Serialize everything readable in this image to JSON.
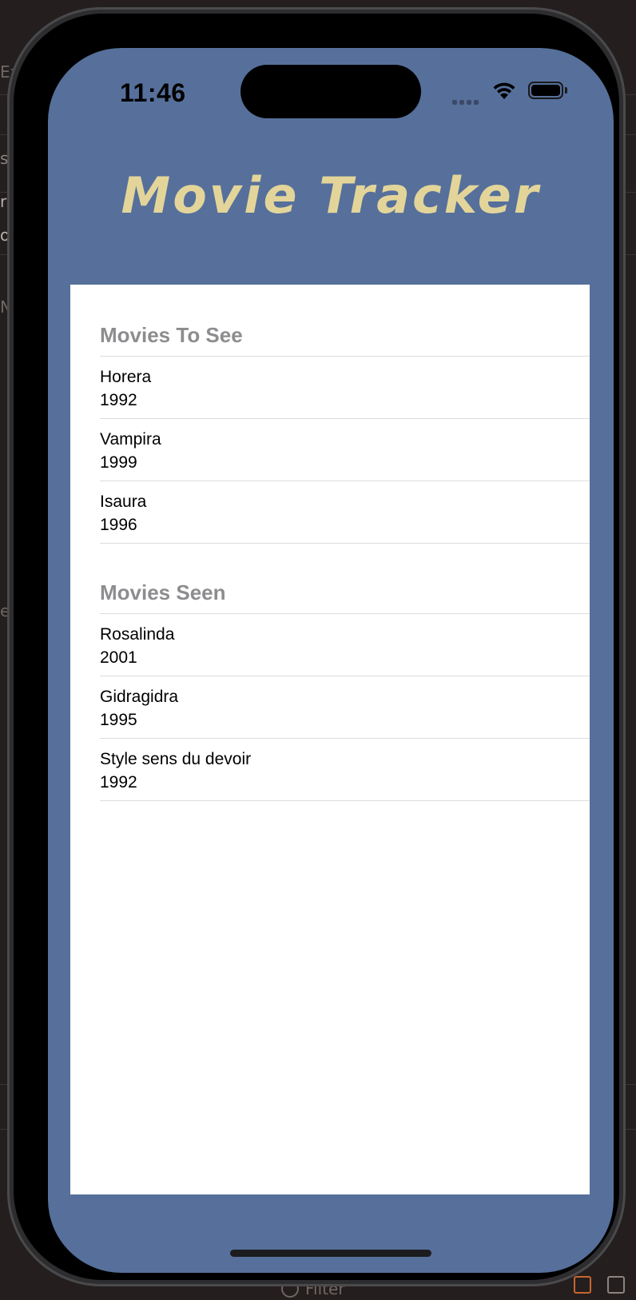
{
  "status_bar": {
    "time": "11:46"
  },
  "app": {
    "title": "Movie Tracker",
    "title_color": "#e3d59a",
    "background_color": "#56709b"
  },
  "sections": [
    {
      "header": "Movies To See",
      "movies": [
        {
          "title": "Horera",
          "year": "1992"
        },
        {
          "title": "Vampira",
          "year": "1999"
        },
        {
          "title": "Isaura",
          "year": "1996"
        }
      ]
    },
    {
      "header": "Movies Seen",
      "movies": [
        {
          "title": "Rosalinda",
          "year": "2001"
        },
        {
          "title": "Gidragidra",
          "year": "1995"
        },
        {
          "title": "Style sens du devoir",
          "year": "1992"
        }
      ]
    }
  ],
  "host_window": {
    "filter_placeholder": "Filter",
    "left_edge_fragments": [
      "Ex",
      "s",
      "r",
      "o",
      "N",
      "e"
    ]
  }
}
